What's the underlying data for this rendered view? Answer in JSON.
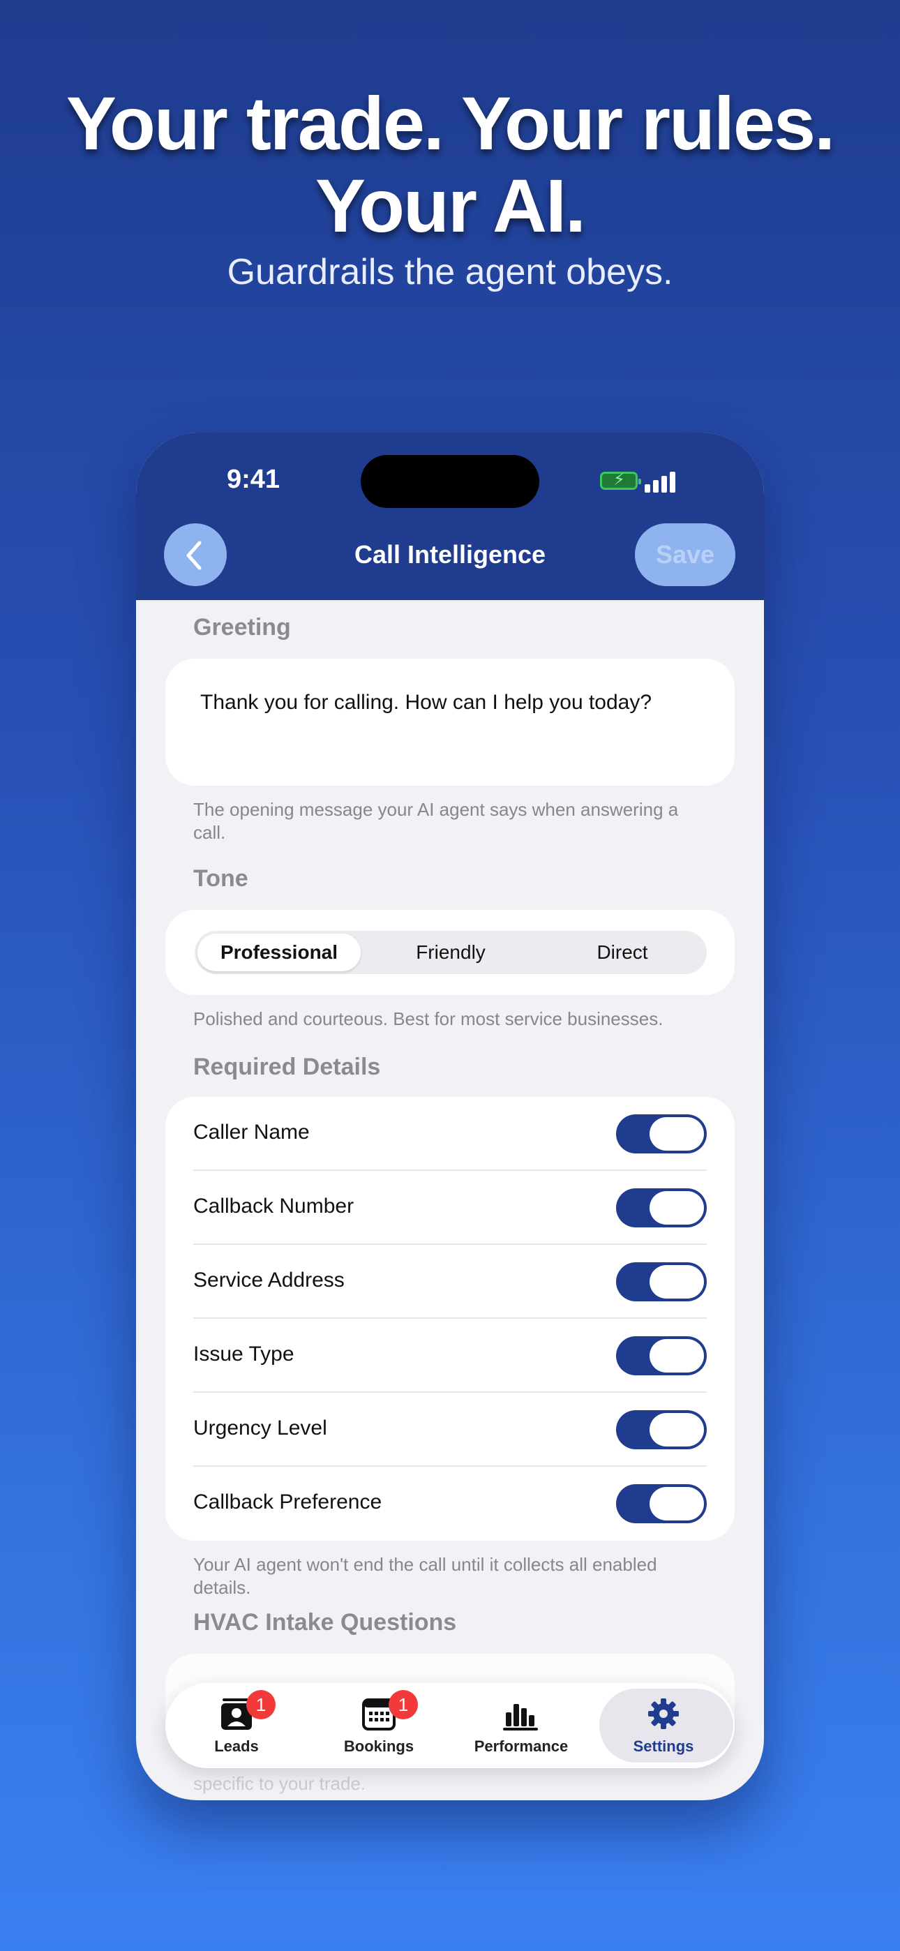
{
  "hero": {
    "title_line1": "Your trade. Your rules.",
    "title_line2": "Your AI.",
    "subtitle": "Guardrails the agent obeys."
  },
  "status_bar": {
    "time": "9:41"
  },
  "nav": {
    "title": "Call Intelligence",
    "save_label": "Save",
    "back_icon": "chevron-left-icon"
  },
  "greeting": {
    "header": "Greeting",
    "text": "Thank you for calling. How can I help you today?",
    "footnote": "The opening message your AI agent says when answering a call."
  },
  "tone": {
    "header": "Tone",
    "options": [
      "Professional",
      "Friendly",
      "Direct"
    ],
    "selected": "Professional",
    "footnote": "Polished and courteous. Best for most service businesses."
  },
  "required_details": {
    "header": "Required Details",
    "items": [
      {
        "label": "Caller Name",
        "enabled": true
      },
      {
        "label": "Callback Number",
        "enabled": true
      },
      {
        "label": "Service Address",
        "enabled": true
      },
      {
        "label": "Issue Type",
        "enabled": true
      },
      {
        "label": "Urgency Level",
        "enabled": true
      },
      {
        "label": "Callback Preference",
        "enabled": true
      }
    ],
    "footnote": "Your AI agent won't end the call until it collects all enabled details."
  },
  "hvac": {
    "header": "HVAC Intake Questions",
    "footnote_partial": "specific to your trade."
  },
  "tabbar": {
    "tabs": [
      {
        "label": "Leads",
        "icon": "contact-card-icon",
        "badge": "1"
      },
      {
        "label": "Bookings",
        "icon": "calendar-icon",
        "badge": "1"
      },
      {
        "label": "Performance",
        "icon": "bar-chart-icon",
        "badge": ""
      },
      {
        "label": "Settings",
        "icon": "gear-icon",
        "badge": ""
      }
    ],
    "active": "Settings"
  },
  "colors": {
    "brand_navy": "#1f3c8e",
    "accent_light_blue": "#8fb3ee",
    "badge_red": "#f23a3a",
    "background_top": "#1f3c8e",
    "background_bottom": "#3a7ff0"
  }
}
